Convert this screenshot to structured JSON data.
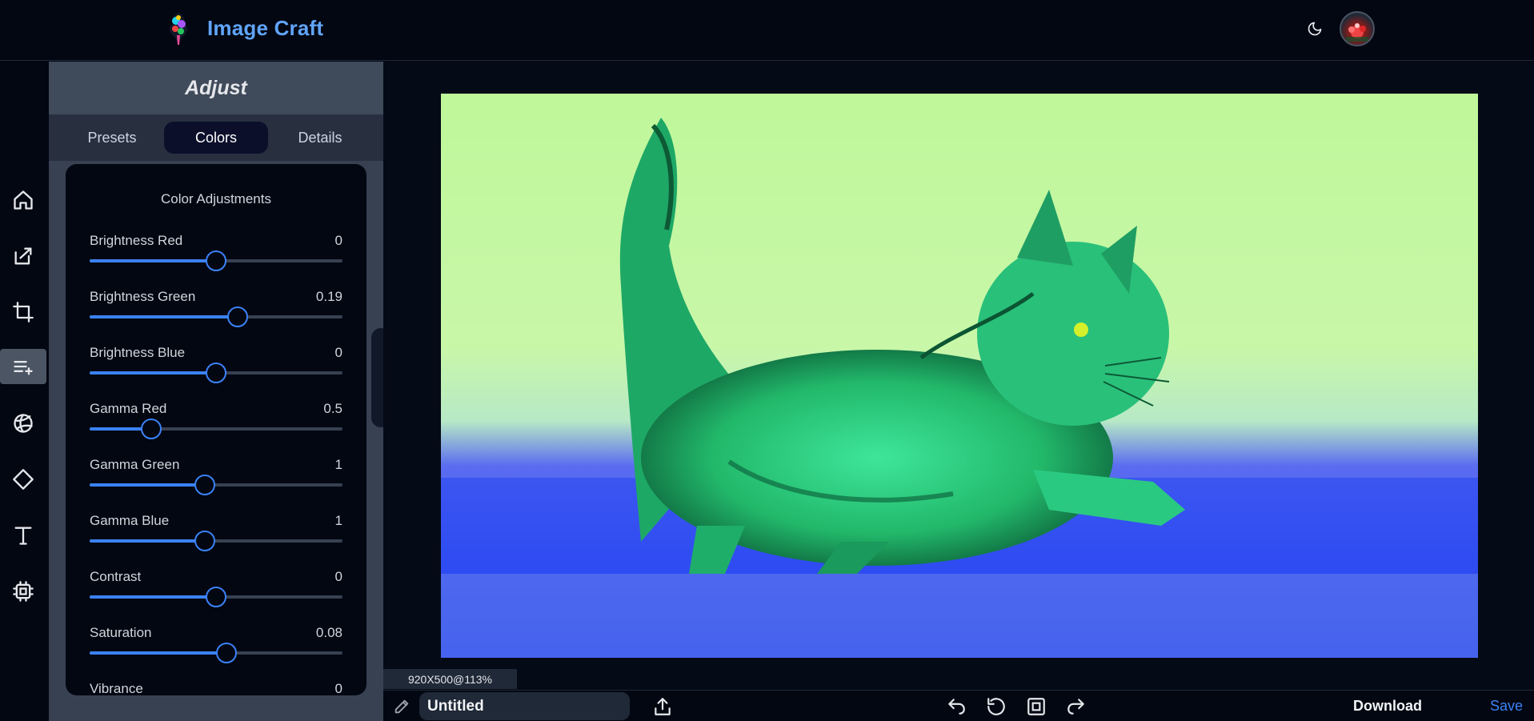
{
  "header": {
    "app_title": "Image Craft",
    "logo_icon": "paint-splash-logo",
    "theme_icon": "moon-icon",
    "avatar_icon": "user-avatar"
  },
  "rail": {
    "items": [
      {
        "name": "home",
        "icon": "home-icon"
      },
      {
        "name": "import",
        "icon": "import-icon"
      },
      {
        "name": "crop",
        "icon": "crop-icon"
      },
      {
        "name": "adjust",
        "icon": "adjust-sliders-icon",
        "active": true
      },
      {
        "name": "filters",
        "icon": "filters-ball-icon"
      },
      {
        "name": "shapes",
        "icon": "diamond-icon"
      },
      {
        "name": "text",
        "icon": "text-icon"
      },
      {
        "name": "ai",
        "icon": "chip-icon"
      }
    ]
  },
  "panel": {
    "title": "Adjust",
    "tabs": [
      {
        "label": "Presets",
        "active": false
      },
      {
        "label": "Colors",
        "active": true
      },
      {
        "label": "Details",
        "active": false
      }
    ],
    "card_title": "Color Adjustments",
    "sliders": [
      {
        "label": "Brightness Red",
        "value": "0",
        "level": 0.5
      },
      {
        "label": "Brightness Green",
        "value": "0.19",
        "level": 0.585
      },
      {
        "label": "Brightness Blue",
        "value": "0",
        "level": 0.5
      },
      {
        "label": "Gamma Red",
        "value": "0.5",
        "level": 0.245
      },
      {
        "label": "Gamma Green",
        "value": "1",
        "level": 0.455
      },
      {
        "label": "Gamma Blue",
        "value": "1",
        "level": 0.455
      },
      {
        "label": "Contrast",
        "value": "0",
        "level": 0.5
      },
      {
        "label": "Saturation",
        "value": "0.08",
        "level": 0.54
      },
      {
        "label": "Vibrance",
        "value": "0",
        "level": 0.5
      }
    ]
  },
  "canvas": {
    "dimensions_label": "920X500@113%"
  },
  "bottombar": {
    "title_value": "Untitled",
    "download_label": "Download",
    "save_label": "Save",
    "icons": [
      "pencil-icon",
      "upload-icon",
      "undo-icon",
      "reset-icon",
      "fit-screen-icon",
      "redo-icon"
    ]
  },
  "colors": {
    "accent": "#3b82f6",
    "brand": "#60a5fa",
    "background": "#030712",
    "panel": "#374151"
  }
}
